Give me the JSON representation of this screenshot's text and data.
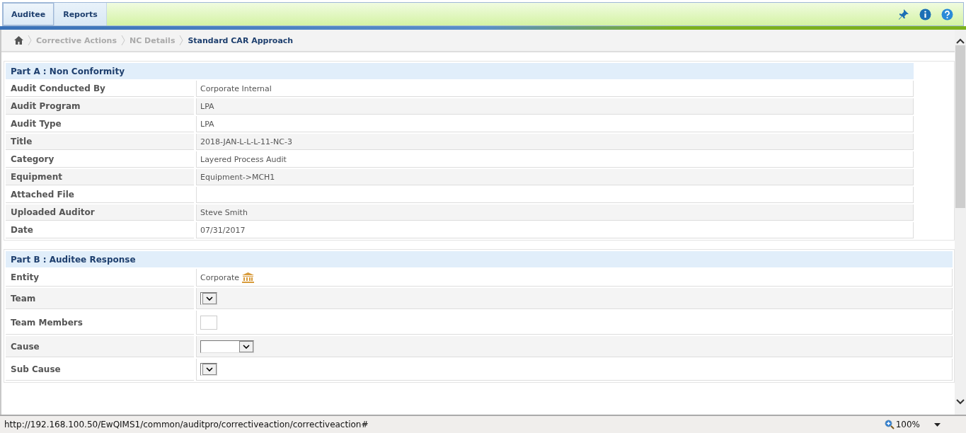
{
  "menu": [
    {
      "label": "Auditee",
      "selected": true
    },
    {
      "label": "Reports",
      "selected": false
    }
  ],
  "breadcrumb": [
    {
      "label": "Corrective Actions",
      "current": false
    },
    {
      "label": "NC Details",
      "current": false
    },
    {
      "label": "Standard CAR Approach",
      "current": true
    }
  ],
  "part_a": {
    "title": "Part A :  Non Conformity",
    "rows": [
      {
        "label": "Audit Conducted By",
        "value": "Corporate Internal"
      },
      {
        "label": "Audit Program",
        "value": "LPA"
      },
      {
        "label": "Audit Type",
        "value": "LPA"
      },
      {
        "label": "Title",
        "value": "2018-JAN-L-L-L-11-NC-3"
      },
      {
        "label": "Category",
        "value": "Layered Process Audit"
      },
      {
        "label": "Equipment",
        "value": "Equipment->MCH1"
      },
      {
        "label": "Attached File"
      },
      {
        "label": "Uploaded Auditor",
        "value": "Steve Smith"
      },
      {
        "label": "Date",
        "value": "07/31/2017"
      }
    ]
  },
  "part_b": {
    "title": "Part B :  Auditee Response",
    "rows": [
      {
        "label": "Entity",
        "kind": "text",
        "value": "Corporate"
      },
      {
        "label": "Team",
        "kind": "select-small"
      },
      {
        "label": "Team Members",
        "kind": "input"
      },
      {
        "label": "Cause",
        "kind": "select-wide"
      },
      {
        "label": "Sub Cause",
        "kind": "select-small"
      }
    ]
  },
  "status_bar": {
    "url": "http://192.168.100.50/EwQIMS1/common/auditpro/correctiveaction/correctiveaction#",
    "zoom": "100%"
  }
}
